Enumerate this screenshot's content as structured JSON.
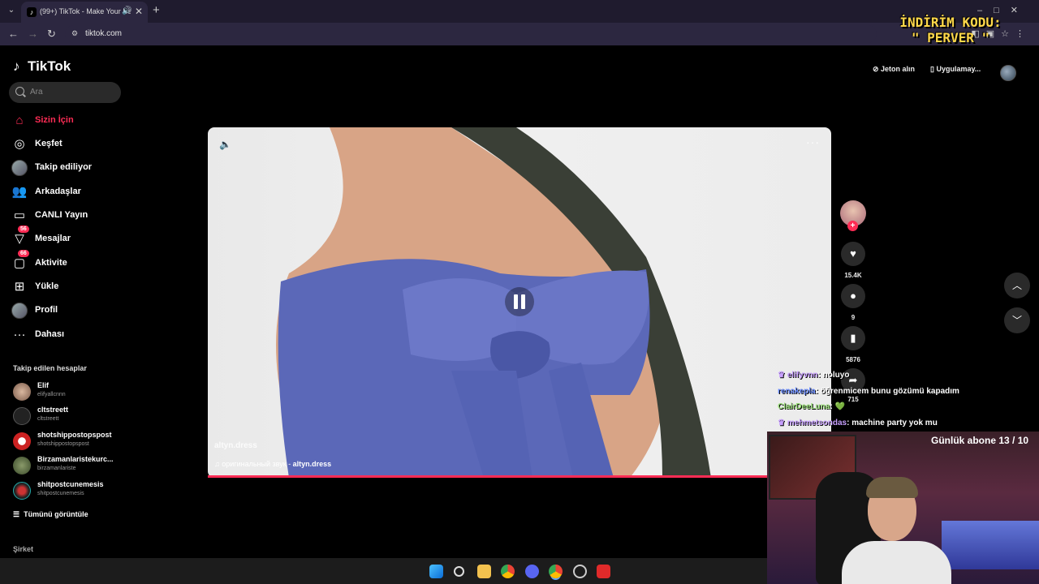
{
  "browser": {
    "tab_title": "(99+) TikTok - Make Your Day",
    "url": "tiktok.com",
    "favicon": "tiktok-icon"
  },
  "promo": {
    "line1": "İNDİRİM KODU:",
    "line2": "\" PERVER \""
  },
  "sidebar": {
    "logo": "TikTok",
    "search_placeholder": "Ara",
    "nav": [
      {
        "label": "Sizin İçin",
        "icon": "home-icon",
        "active": true
      },
      {
        "label": "Keşfet",
        "icon": "compass-icon"
      },
      {
        "label": "Takip ediliyor",
        "icon": "following-avatar-icon"
      },
      {
        "label": "Arkadaşlar",
        "icon": "friends-icon"
      },
      {
        "label": "CANLI Yayın",
        "icon": "live-icon"
      },
      {
        "label": "Mesajlar",
        "icon": "messages-icon",
        "badge": "56"
      },
      {
        "label": "Aktivite",
        "icon": "activity-icon",
        "badge": "66"
      },
      {
        "label": "Yükle",
        "icon": "upload-icon"
      },
      {
        "label": "Profil",
        "icon": "profile-avatar-icon"
      },
      {
        "label": "Dahası",
        "icon": "more-dots-icon"
      }
    ],
    "following_title": "Takip edilen hesaplar",
    "accounts": [
      {
        "name": "Elif",
        "handle": "elifyallcnnn"
      },
      {
        "name": "cltstreett",
        "handle": "cltstreett"
      },
      {
        "name": "shotshippostopspost",
        "handle": "shotshippostopspost"
      },
      {
        "name": "Birzamanlaristekurc...",
        "handle": "birzamanlariste"
      },
      {
        "name": "shitpostcunemesis",
        "handle": "shitpostcunemesis"
      }
    ],
    "see_all": "Tümünü görüntüle",
    "company": "Şirket"
  },
  "topbar": {
    "coins": "Jeton alın",
    "app": "Uygulamay..."
  },
  "video": {
    "author": "altyn.dress",
    "sound_label": "оригинальный звук - ",
    "sound_author": "altyn.dress",
    "progress_fraction": 0.9
  },
  "actions": {
    "likes": "15.4K",
    "comments": "9",
    "saves": "5876",
    "shares": "715"
  },
  "chat": [
    {
      "user": "elifyvnn",
      "msg": ": noluyo",
      "color": "#c8a0ff"
    },
    {
      "user": "renakepla",
      "msg": ": öğrenmicem bunu gözümü kapadım",
      "color": "#6a8cff"
    },
    {
      "user": "ClairDeeLuna",
      "msg": ": 💚",
      "color": "#9be07a"
    },
    {
      "user": "mehmetsondas",
      "msg": ": machine party yok mu",
      "color": "#c8a0ff"
    }
  ],
  "subgoal": "Günlük abone 13 / 10",
  "colors": {
    "accent": "#fe2c55",
    "sidebar_bg": "#000000",
    "chrome_bg": "#2c2740"
  }
}
